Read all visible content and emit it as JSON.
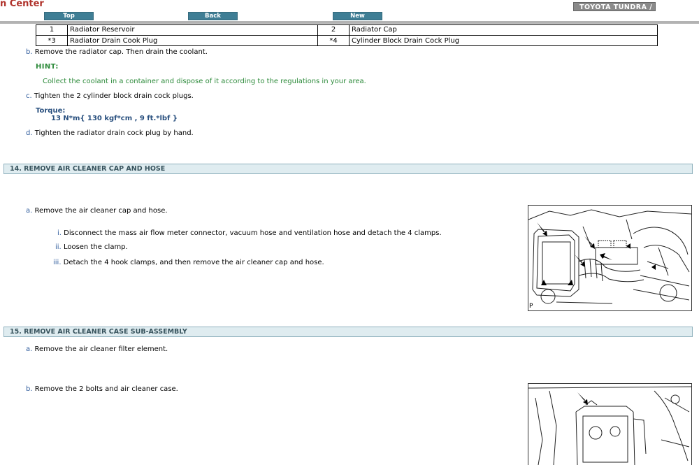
{
  "header": {
    "title_fragment": "n Center",
    "nav": {
      "top": "Top",
      "back": "Back",
      "new": "New"
    },
    "model": "TOYOTA TUNDRA /"
  },
  "parts_table": {
    "rows": [
      {
        "n1": "1",
        "name1": "Radiator Reservoir",
        "n2": "2",
        "name2": "Radiator Cap"
      },
      {
        "n1": "*3",
        "name1": "Radiator Drain Cook Plug",
        "n2": "*4",
        "name2": "Cylinder Block Drain Cock Plug"
      }
    ]
  },
  "steps_13": {
    "b": {
      "label": "b.",
      "text": "Remove the radiator cap. Then drain the coolant."
    },
    "hint_label": "HINT:",
    "hint_text": "Collect the coolant in a container and dispose of it according to the regulations in your area.",
    "c": {
      "label": "c.",
      "text": "Tighten the 2 cylinder block drain cock plugs."
    },
    "torque_label": "Torque:",
    "torque_value": "13 N*m{ 130 kgf*cm , 9 ft.*lbf }",
    "d": {
      "label": "d.",
      "text": "Tighten the radiator drain cock plug by hand."
    }
  },
  "section_14": {
    "heading": "14. REMOVE AIR CLEANER CAP AND HOSE",
    "a": {
      "label": "a.",
      "text": "Remove the air cleaner cap and hose."
    },
    "sub": [
      {
        "label": "i.",
        "text": "Disconnect the mass air flow meter connector, vacuum hose and ventilation hose and detach the 4 clamps."
      },
      {
        "label": "ii.",
        "text": "Loosen the clamp."
      },
      {
        "label": "iii.",
        "text": "Detach the 4 hook clamps, and then remove the air cleaner cap and hose."
      }
    ],
    "figure_tag": "P"
  },
  "section_15": {
    "heading": "15. REMOVE AIR CLEANER CASE SUB-ASSEMBLY",
    "a": {
      "label": "a.",
      "text": "Remove the air cleaner filter element."
    },
    "b": {
      "label": "b.",
      "text": "Remove the 2 bolts and air cleaner case."
    }
  }
}
